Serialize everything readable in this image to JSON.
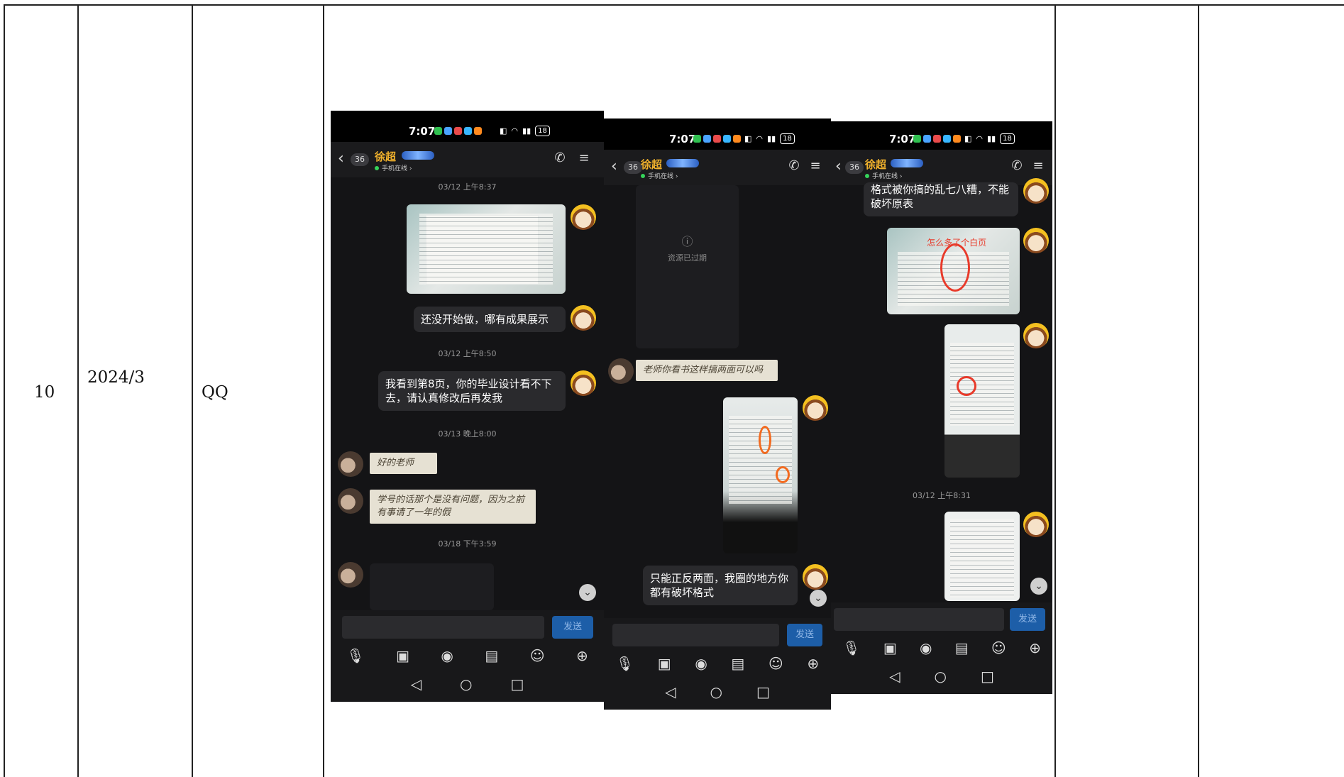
{
  "row": {
    "index": "10",
    "date": "2024/3",
    "platform": "QQ"
  },
  "status": {
    "time": "7:07",
    "battery": "18"
  },
  "chat": {
    "contact_name": "徐超",
    "unread": "36",
    "online_status": "手机在线 ›",
    "send_label": "发送"
  },
  "screen1": {
    "ts1": "03/12 上午8:37",
    "msg1": "还没开始做，哪有成果展示",
    "ts2": "03/12 上午8:50",
    "msg2": "我看到第8页，你的毕业设计看不下去，请认真修改后再发我",
    "ts3": "03/13 晚上8:00",
    "msg3": "好的老师",
    "msg4": "学号的话那个是没有问题，因为之前有事请了一年的假",
    "ts4": "03/18 下午3:59"
  },
  "screen2": {
    "expired": "资源已过期",
    "msg1": "老师你看书这样搞两面可以吗",
    "msg2": "只能正反两面，我圈的地方你都有破坏格式"
  },
  "screen3": {
    "msg1": "格式被你搞的乱七八糟，不能破坏原表",
    "photo_caption": "怎么多了个白页",
    "ts1": "03/12 上午8:31"
  },
  "colors": {
    "chat_bg": "#141416",
    "accent_name": "#f0b12c",
    "send_button": "#1d5ea8"
  }
}
